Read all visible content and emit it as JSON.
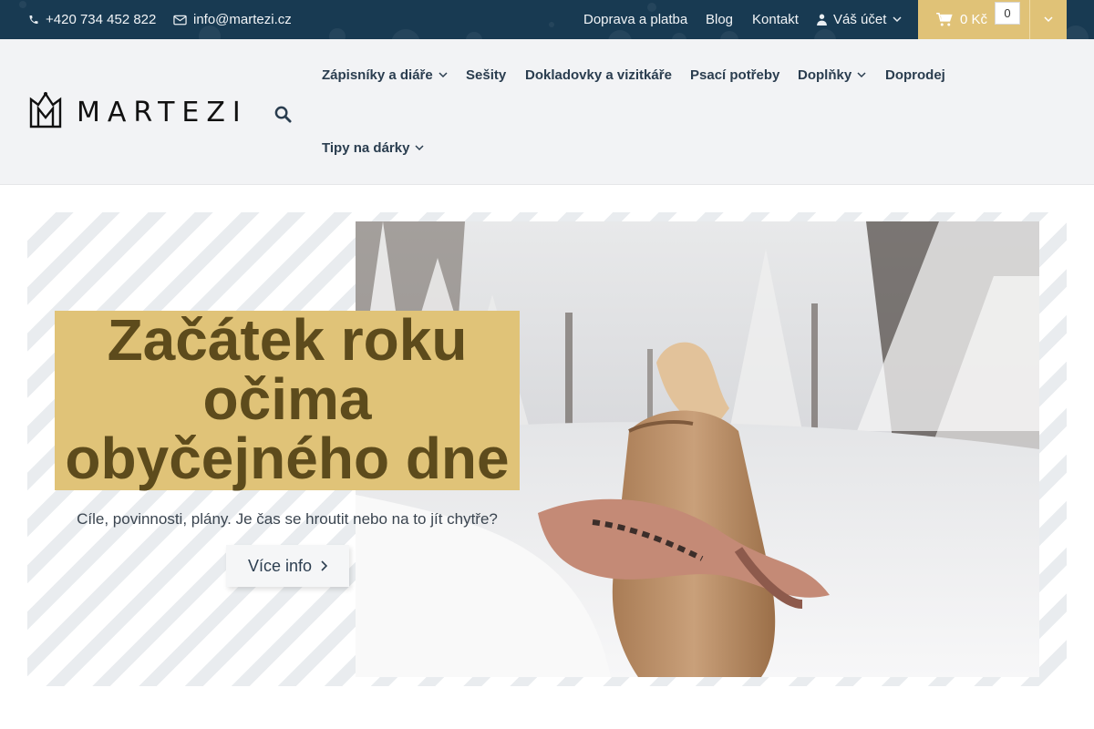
{
  "topbar": {
    "phone": "+420 734 452 822",
    "email": "info@martezi.cz",
    "links": {
      "shipping": "Doprava a platba",
      "blog": "Blog",
      "contact": "Kontakt",
      "account": "Váš účet"
    },
    "cart_total": "0 Kč",
    "cart_count": "0",
    "background_color": "#183a52",
    "cart_color": "#e0c277"
  },
  "header": {
    "logo_text": "MARTEZI",
    "nav": {
      "notebooks": "Zápisníky a diáře",
      "workbooks": "Sešity",
      "cases": "Dokladovky a vizitkáře",
      "writing": "Psací potřeby",
      "accessories": "Doplňky",
      "sale": "Doprodej",
      "gifts": "Tipy na dárky"
    }
  },
  "hero": {
    "headline": [
      "Začátek roku",
      "očima",
      "obyčejného dne"
    ],
    "subtitle": "Cíle, povinnosti, plány. Je čas se hroutit nebo na to jít chytře?",
    "button_label": "Více info",
    "accent_color": "#e0c378"
  },
  "icons": [
    "phone-icon",
    "mail-icon",
    "user-icon",
    "chevron-down-icon",
    "cart-icon",
    "search-icon",
    "chevron-right-icon",
    "logo-crown-icon"
  ]
}
